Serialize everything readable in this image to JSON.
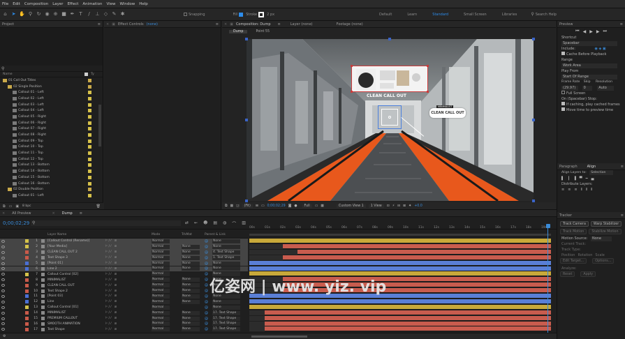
{
  "menu": [
    "File",
    "Edit",
    "Composition",
    "Layer",
    "Effect",
    "Animation",
    "View",
    "Window",
    "Help"
  ],
  "toolbar": {
    "snapping": "Snapping",
    "stroke_px": "2 px",
    "workspaces": [
      "Default",
      "Learn",
      "Standard",
      "Small Screen",
      "Libraries"
    ],
    "active_workspace": "Standard",
    "search_placeholder": "Search Help"
  },
  "project": {
    "title": "Project",
    "search_icon": "search-icon",
    "col_name": "Name",
    "items": [
      {
        "type": "folder",
        "label": "01 Call Out Titles",
        "indent": 0
      },
      {
        "type": "folder",
        "label": "02 Single Position",
        "indent": 1
      },
      {
        "type": "comp",
        "label": "Callout 01 - Left",
        "indent": 2
      },
      {
        "type": "comp",
        "label": "Callout 02 - Left",
        "indent": 2
      },
      {
        "type": "comp",
        "label": "Callout 03 - Left",
        "indent": 2
      },
      {
        "type": "comp",
        "label": "Callout 04 - Left",
        "indent": 2
      },
      {
        "type": "comp",
        "label": "Callout 05 - Right",
        "indent": 2
      },
      {
        "type": "comp",
        "label": "Callout 06 - Right",
        "indent": 2
      },
      {
        "type": "comp",
        "label": "Callout 07 - Right",
        "indent": 2
      },
      {
        "type": "comp",
        "label": "Callout 08 - Right",
        "indent": 2
      },
      {
        "type": "comp",
        "label": "Callout 09 - Top",
        "indent": 2
      },
      {
        "type": "comp",
        "label": "Callout 10 - Top",
        "indent": 2
      },
      {
        "type": "comp",
        "label": "Callout 11 - Top",
        "indent": 2
      },
      {
        "type": "comp",
        "label": "Callout 12 - Top",
        "indent": 2
      },
      {
        "type": "comp",
        "label": "Callout 13 - Bottom",
        "indent": 2
      },
      {
        "type": "comp",
        "label": "Callout 14 - Bottom",
        "indent": 2
      },
      {
        "type": "comp",
        "label": "Callout 15 - Bottom",
        "indent": 2
      },
      {
        "type": "comp",
        "label": "Callout 16 - Bottom",
        "indent": 2
      },
      {
        "type": "folder",
        "label": "02 Double Position",
        "indent": 1
      },
      {
        "type": "comp",
        "label": "Callout 01 - Left",
        "indent": 2
      }
    ],
    "bpc": "8 bpc"
  },
  "effect_controls": {
    "title": "Effect Controls",
    "value": "(none)"
  },
  "viewer": {
    "tab_title": "Composition: Dump",
    "tabs": [
      "Dump",
      "Point 55"
    ],
    "layer_tab": "Layer (none)",
    "footage_tab": "Footage (none)",
    "zoom": "(Fit)",
    "timecode": "0;00;02;29",
    "resolution": "Full",
    "camera": "Custom View 1",
    "views": "1 View",
    "exposure": "+0.0",
    "callout_label": "CLEAN CALL OUT",
    "callout_small": "MINIMALIST",
    "hud_label": "CLEAN CALL OUT"
  },
  "preview": {
    "title": "Preview",
    "shortcut_label": "Shortcut",
    "shortcut_value": "Spacebar",
    "include_label": "Include:",
    "cache_before": "Cache Before Playback",
    "range_label": "Range",
    "range_value": "Work Area",
    "play_from_label": "Play From",
    "play_from_value": "Start Of Range",
    "frame_rate_label": "Frame Rate",
    "skip_label": "Skip",
    "resolution_label": "Resolution",
    "frame_rate_value": "(29.97)",
    "skip_value": "0",
    "resolution_value": "Auto",
    "full_screen": "Full Screen",
    "on_stop_label": "On (Spacebar) Stop:",
    "if_caching": "If caching, play cached frames",
    "move_time": "Move time to preview time"
  },
  "align": {
    "tabs": [
      "Paragraph",
      "Align"
    ],
    "active": "Align",
    "align_layers_to": "Align Layers to:",
    "align_value": "Selection",
    "distribute": "Distribute Layers:"
  },
  "tracker": {
    "title": "Tracker",
    "track_camera": "Track Camera",
    "warp_stabilizer": "Warp Stabilizer",
    "motion_source": "Motion Source:",
    "motion_value": "None",
    "current_track": "Current Track:",
    "track_type": "Track Type:",
    "position": "Position",
    "rotation": "Rotation",
    "scale": "Scale",
    "edit_target": "Edit Target...",
    "options": "Options...",
    "analyze": "Analyze:",
    "reset": "Reset",
    "apply": "Apply"
  },
  "timeline": {
    "tabs": [
      "All Preview",
      "Dump"
    ],
    "timecode": "0;00;02;29",
    "col_source": "Layer Name",
    "col_mode": "Mode",
    "col_trkmat": "TrkMat",
    "col_parent": "Parent & Link",
    "ruler": [
      "00s",
      "01s",
      "02s",
      "03s",
      "04s",
      "05s",
      "06s",
      "07s",
      "08s",
      "09s",
      "10s",
      "11s",
      "12s",
      "13s",
      "14s",
      "15s",
      "16s",
      "17s",
      "18s",
      "19s"
    ],
    "layers": [
      {
        "n": "1",
        "name": "[Callout Control (Rename)]",
        "mode": "Normal",
        "trk": "",
        "parent": "None",
        "label": "#d4c24a",
        "sel": true,
        "bar": "#c8a93a",
        "start": 0.0,
        "end": 1.0
      },
      {
        "n": "2",
        "name": "[Your Media]",
        "mode": "Normal",
        "trk": "None",
        "parent": "None",
        "label": "#d4c24a",
        "sel": true,
        "bar": "#c85c4e",
        "start": 0.11,
        "end": 1.0
      },
      {
        "n": "3",
        "name": "CLEAN CALL OUT 2",
        "mode": "Normal",
        "trk": "None",
        "parent": "4. Text Shape",
        "label": "#c95a4a",
        "sel": true,
        "bar": "#c85c4e",
        "start": 0.16,
        "end": 1.0
      },
      {
        "n": "4",
        "name": "Text Shape 3",
        "mode": "Normal",
        "trk": "None",
        "parent": "1. Text Shape",
        "label": "#c95a4a",
        "sel": true,
        "bar": "#c85c4e",
        "start": 0.11,
        "end": 1.0
      },
      {
        "n": "5",
        "name": "[Point 01]",
        "mode": "Normal",
        "trk": "None",
        "parent": "None",
        "label": "#4a6fd4",
        "sel": true,
        "bar": "#5a7fd6",
        "start": 0.0,
        "end": 1.0
      },
      {
        "n": "6",
        "name": "Line 2",
        "mode": "Normal",
        "trk": "None",
        "parent": "None",
        "label": "#4a6fd4",
        "sel": true,
        "bar": "#5a7fd6",
        "start": 0.0,
        "end": 1.0
      },
      {
        "n": "7",
        "name": "Callout Control [02]",
        "mode": "Normal",
        "trk": "",
        "parent": "None",
        "label": "#d4c24a",
        "sel": false,
        "bar": "#c8a93a",
        "start": 0.0,
        "end": 1.0
      },
      {
        "n": "8",
        "name": "MINIMALIST",
        "mode": "Normal",
        "trk": "None",
        "parent": "None",
        "label": "#c95a4a",
        "sel": false,
        "bar": "#c85c4e",
        "start": 0.11,
        "end": 1.0
      },
      {
        "n": "9",
        "name": "CLEAN CALL OUT",
        "mode": "Normal",
        "trk": "None",
        "parent": "None",
        "label": "#c95a4a",
        "sel": false,
        "bar": "#c85c4e",
        "start": 0.11,
        "end": 1.0
      },
      {
        "n": "10",
        "name": "Text Shape 2",
        "mode": "Normal",
        "trk": "None",
        "parent": "None",
        "label": "#c95a4a",
        "sel": false,
        "bar": "#c85c4e",
        "start": 0.11,
        "end": 1.0
      },
      {
        "n": "11",
        "name": "[Point 03]",
        "mode": "Normal",
        "trk": "None",
        "parent": "None",
        "label": "#4a6fd4",
        "sel": false,
        "bar": "#5a7fd6",
        "start": 0.0,
        "end": 1.0
      },
      {
        "n": "12",
        "name": "Line",
        "mode": "Normal",
        "trk": "None",
        "parent": "None",
        "label": "#4a6fd4",
        "sel": false,
        "bar": "#5a7fd6",
        "start": 0.0,
        "end": 1.0
      },
      {
        "n": "13",
        "name": "Callout Control [01]",
        "mode": "Normal",
        "trk": "",
        "parent": "None",
        "label": "#d4c24a",
        "sel": false,
        "bar": "#c8a93a",
        "start": 0.0,
        "end": 1.0
      },
      {
        "n": "14",
        "name": "MINIMALIST",
        "mode": "Normal",
        "trk": "None",
        "parent": "17. Text Shape",
        "label": "#c95a4a",
        "sel": false,
        "bar": "#c85c4e",
        "start": 0.05,
        "end": 1.0
      },
      {
        "n": "15",
        "name": "PREMIUM CALLOUT",
        "mode": "Normal",
        "trk": "None",
        "parent": "17. Text Shape",
        "label": "#c95a4a",
        "sel": false,
        "bar": "#c85c4e",
        "start": 0.05,
        "end": 1.0
      },
      {
        "n": "16",
        "name": "SMOOTH ANIMATION",
        "mode": "Normal",
        "trk": "None",
        "parent": "17. Text Shape",
        "label": "#c95a4a",
        "sel": false,
        "bar": "#c85c4e",
        "start": 0.05,
        "end": 1.0
      },
      {
        "n": "17",
        "name": "Text Shape",
        "mode": "Normal",
        "trk": "None",
        "parent": "17. Text Shape",
        "label": "#c95a4a",
        "sel": false,
        "bar": "#c85c4e",
        "start": 0.05,
        "end": 1.0
      }
    ]
  },
  "watermark": "亿姿网 | www. yiz. vip",
  "colors": {
    "accent": "#2d8ceb",
    "escalator_orange": "#e8581c"
  }
}
